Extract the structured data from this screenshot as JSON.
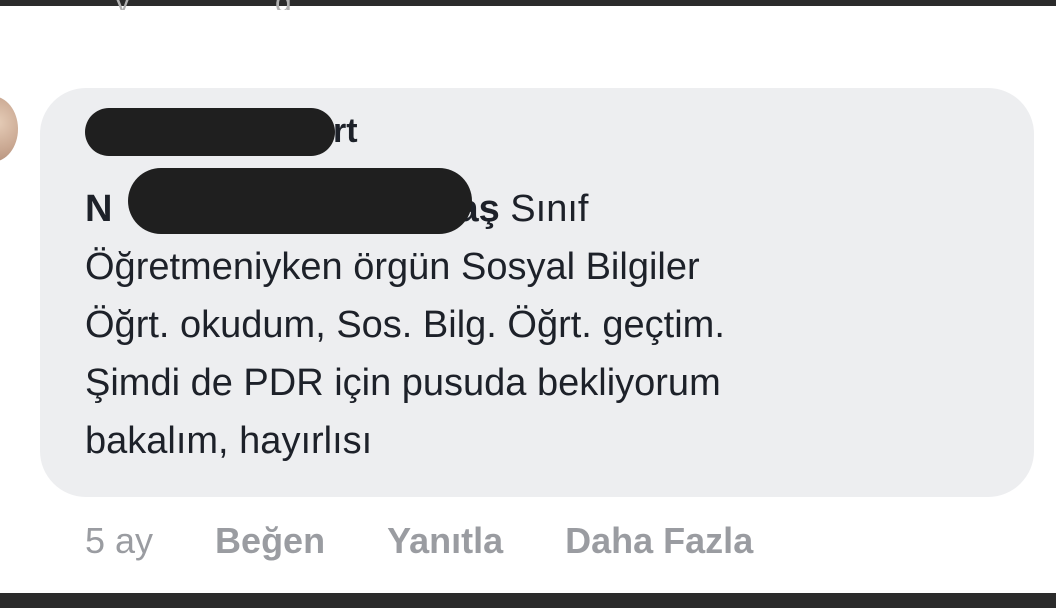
{
  "top_fragment": {
    "left_text": "y",
    "right_text": "g"
  },
  "comment": {
    "author_visible_fragment": "rt",
    "line1": {
      "start": "N",
      "end_bold": "aş",
      "end_normal": " Sınıf"
    },
    "lines": [
      "Öğretmeniyken örgün Sosyal Bilgiler",
      "Öğrt. okudum, Sos. Bilg. Öğrt. geçtim.",
      "Şimdi de PDR için pusuda bekliyorum",
      "bakalım, hayırlısı"
    ]
  },
  "actions": {
    "timestamp": "5 ay",
    "like_label": "Beğen",
    "reply_label": "Yanıtla",
    "more_label": "Daha Fazla"
  },
  "colors": {
    "bubble": "#edeef0",
    "text": "#1d2129",
    "muted": "#9a9ca1",
    "redaction": "#1f1f1f",
    "frame": "#2b2b2b"
  }
}
